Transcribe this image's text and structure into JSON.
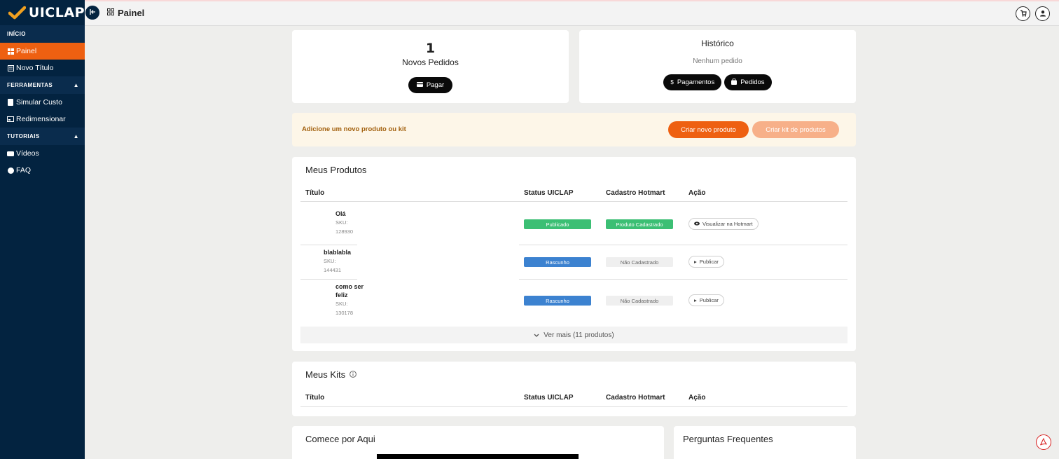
{
  "brand": {
    "name": "UICLAP",
    "accent": "#ee6011",
    "sidebar_bg": "#032340"
  },
  "sidebar": {
    "sections": [
      {
        "label": "INÍCIO"
      },
      {
        "label": "FERRAMENTAS",
        "chevron": "chevron-up-icon"
      },
      {
        "label": "TUTORIAIS",
        "chevron": "chevron-up-icon"
      }
    ],
    "items": [
      {
        "label": "Painel",
        "icon": "grid-icon",
        "active": true
      },
      {
        "label": "Novo Título",
        "icon": "book-icon"
      },
      {
        "label": "Simular Custo",
        "icon": "calculator-icon"
      },
      {
        "label": "Redimensionar",
        "icon": "resize-icon"
      },
      {
        "label": "Vídeos",
        "icon": "video-icon"
      },
      {
        "label": "FAQ",
        "icon": "question-icon"
      }
    ]
  },
  "topbar": {
    "title": "Painel",
    "icons": [
      "cart-icon",
      "user-icon"
    ]
  },
  "orders_card": {
    "count": "1",
    "label": "Novos Pedidos",
    "pay_button": "Pagar"
  },
  "history_card": {
    "title": "Histórico",
    "empty": "Nenhum pedido",
    "payments_button": "Pagamentos",
    "orders_button": "Pedidos"
  },
  "banner": {
    "text": "Adicione um novo produto ou kit",
    "create_product": "Criar novo produto",
    "create_kit": "Criar kit de produtos"
  },
  "products": {
    "title": "Meus Produtos",
    "columns": [
      "Título",
      "Status UICLAP",
      "Cadastro Hotmart",
      "Ação"
    ],
    "rows": [
      {
        "name": "Olá",
        "sku_label": "SKU:",
        "sku": "128930",
        "status": "Publicado",
        "hotmart": "Produto Cadastrado",
        "action": "Visualizar na Hotmart"
      },
      {
        "name": "blablabla",
        "sku_label": "SKU:",
        "sku": "144431",
        "status": "Rascunho",
        "hotmart": "Não Cadastrado",
        "action": "Publicar"
      },
      {
        "name_line1": "como ser",
        "name_line2": "feliz",
        "sku_label": "SKU:",
        "sku": "130178",
        "status": "Rascunho",
        "hotmart": "Não Cadastrado",
        "action": "Publicar"
      }
    ],
    "more": "Ver mais (11 produtos)"
  },
  "kits": {
    "title": "Meus Kits",
    "columns": [
      "Título",
      "Status UICLAP",
      "Cadastro Hotmart",
      "Ação"
    ]
  },
  "start": {
    "title": "Comece por Aqui"
  },
  "faq": {
    "title": "Perguntas Frequentes"
  }
}
